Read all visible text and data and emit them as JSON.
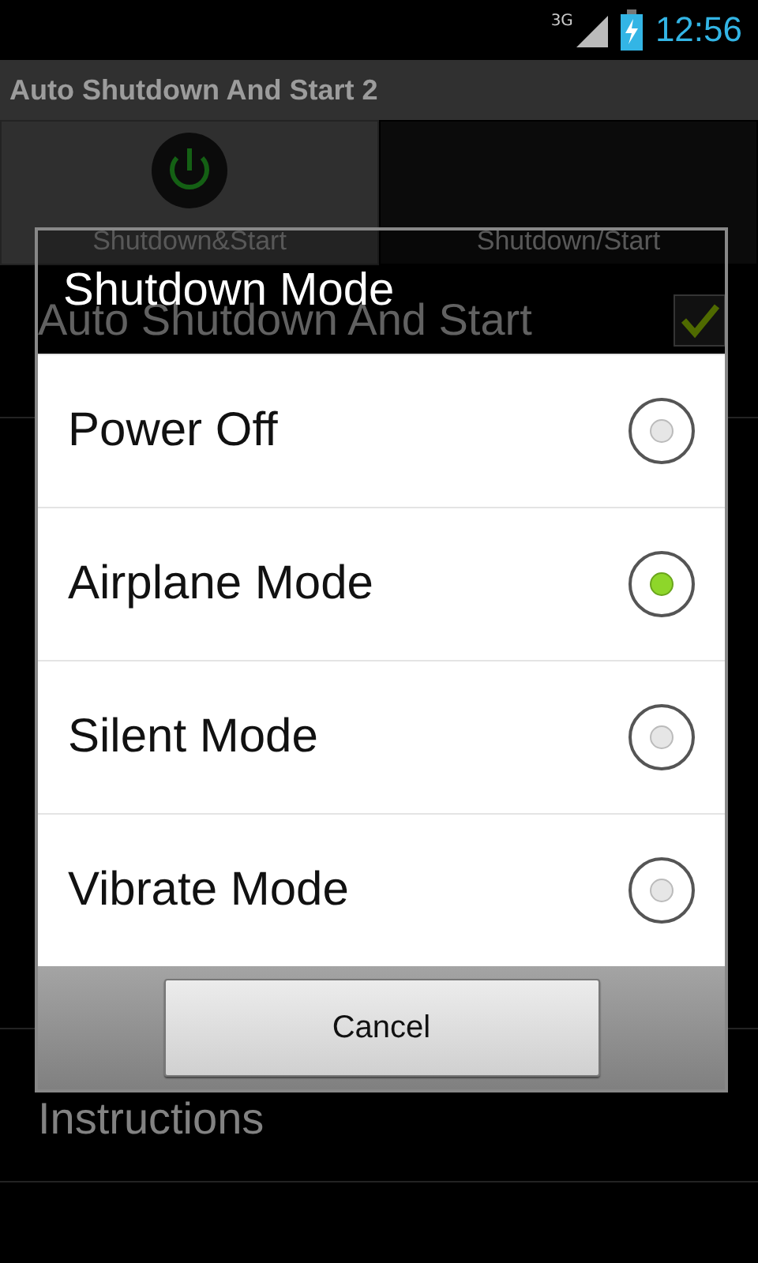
{
  "status_bar": {
    "network": "3G",
    "time": "12:56"
  },
  "action_bar": {
    "title": "Auto Shutdown And Start 2"
  },
  "tabs": [
    {
      "label": "Shutdown&Start",
      "selected": true
    },
    {
      "label": "Shutdown/Start",
      "selected": false
    }
  ],
  "list": [
    {
      "kind": "checkbox",
      "label": "Auto Shutdown And Start",
      "checked": true
    },
    {
      "kind": "plain",
      "label": "Instructions"
    }
  ],
  "dialog": {
    "title": "Shutdown Mode",
    "options": [
      {
        "label": "Power Off",
        "selected": false
      },
      {
        "label": "Airplane Mode",
        "selected": true
      },
      {
        "label": "Silent Mode",
        "selected": false
      },
      {
        "label": "Vibrate Mode",
        "selected": false
      }
    ],
    "buttons": [
      "Cancel"
    ]
  }
}
